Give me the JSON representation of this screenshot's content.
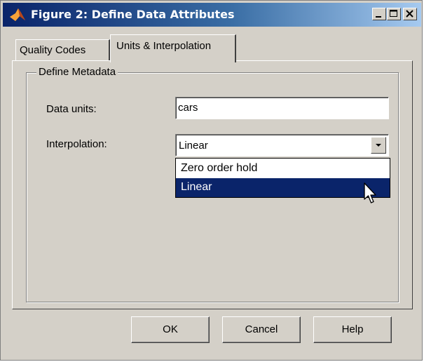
{
  "window": {
    "title": "Figure 2: Define Data Attributes",
    "icon": "matlab-logo-icon",
    "controls": [
      "minimize-icon",
      "maximize-icon",
      "close-icon"
    ],
    "titlebar_color": "#0a246a"
  },
  "tabs": [
    {
      "label": "Quality Codes",
      "selected": false
    },
    {
      "label": "Units & Interpolation",
      "selected": true
    }
  ],
  "metadata": {
    "group_label": "Define Metadata",
    "data_units_label": "Data units:",
    "data_units_value": "cars",
    "interpolation_label": "Interpolation:",
    "interpolation_value": "Linear",
    "interpolation_options": [
      "Zero order hold",
      "Linear"
    ],
    "highlighted_option": "Linear"
  },
  "buttons": {
    "ok": "OK",
    "cancel": "Cancel",
    "help": "Help"
  },
  "colors": {
    "selection": "#0a246a",
    "dialog_bg": "#d4d0c8"
  }
}
